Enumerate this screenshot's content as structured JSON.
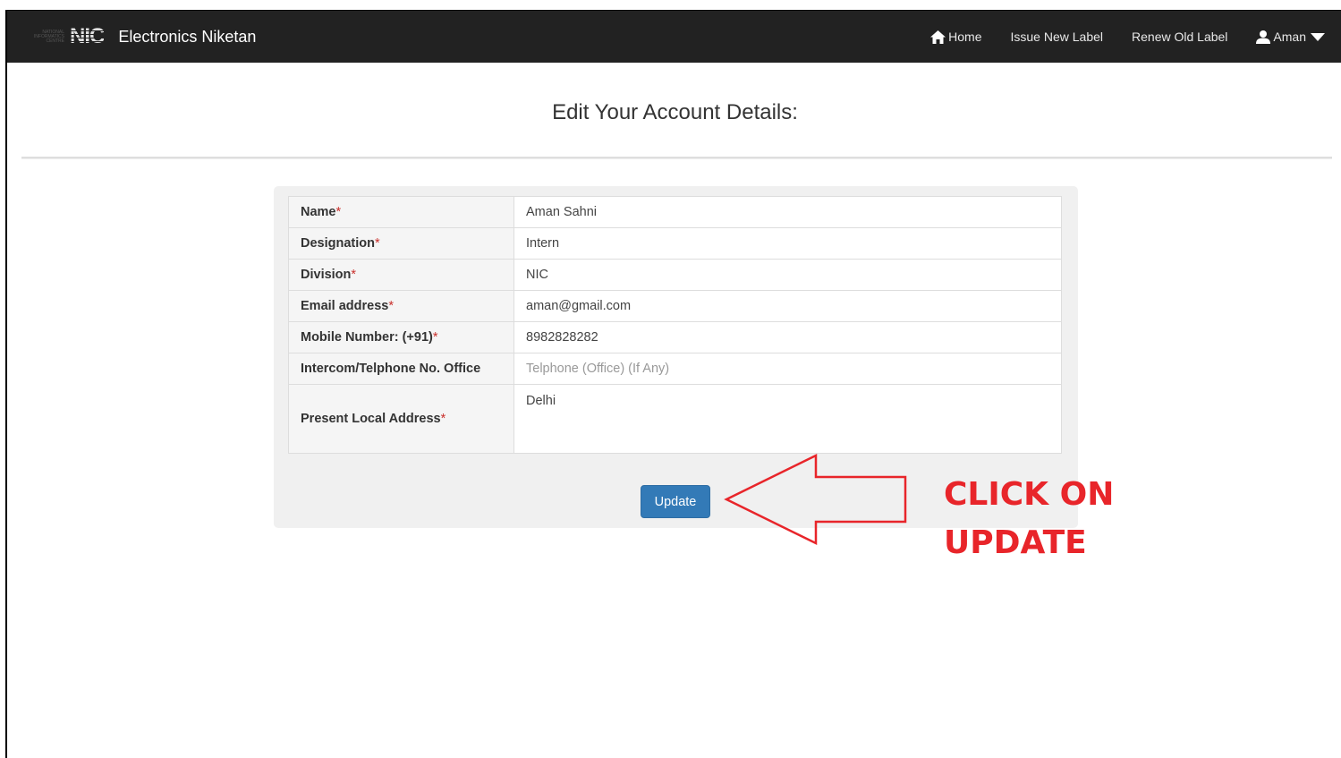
{
  "brand": {
    "logo_small": "NATIONAL INFORMATICS CENTRE",
    "logo_text": "NIC",
    "name": "Electronics Niketan"
  },
  "nav": {
    "home": "Home",
    "issue": "Issue New Label",
    "renew": "Renew Old Label",
    "user": "Aman"
  },
  "page": {
    "title": "Edit Your Account Details:"
  },
  "form": {
    "fields": [
      {
        "label": "Name",
        "required": "*",
        "value": "Aman Sahni",
        "placeholder": ""
      },
      {
        "label": "Designation",
        "required": "*",
        "value": "Intern",
        "placeholder": ""
      },
      {
        "label": "Division",
        "required": "*",
        "value": "NIC",
        "placeholder": ""
      },
      {
        "label": "Email address",
        "required": "*",
        "value": "aman@gmail.com",
        "placeholder": ""
      },
      {
        "label": "Mobile Number: (+91)",
        "required": "*",
        "value": "8982828282",
        "placeholder": ""
      },
      {
        "label": "Intercom/Telphone No. Office",
        "required": "",
        "value": "",
        "placeholder": "Telphone (Office) (If Any)"
      },
      {
        "label": "Present Local Address",
        "required": "*",
        "value": "Delhi",
        "placeholder": ""
      }
    ],
    "submit_label": "Update"
  },
  "annotation": {
    "line1": "CLICK ON",
    "line2": "UPDATE",
    "color": "#e8252a"
  },
  "colors": {
    "navbar": "#222222",
    "button": "#337ab7",
    "required": "#c9302c"
  }
}
